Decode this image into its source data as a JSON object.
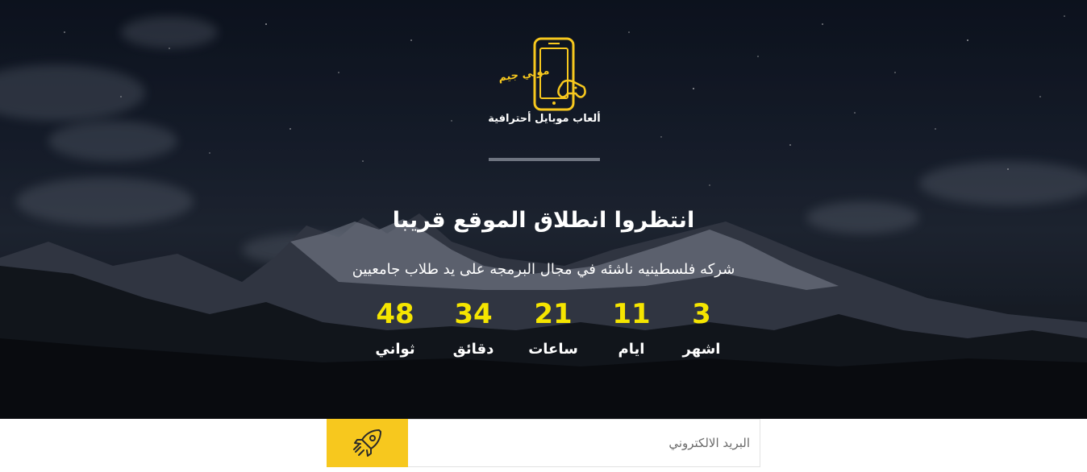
{
  "brand": {
    "name": "موبي جيم",
    "tagline": "ألعاب موبايل أحترافية"
  },
  "hero": {
    "headline": "انتظروا انطلاق الموقع قريبا",
    "subline": "شركه فلسطينيه ناشئه في مجال البرمجه على يد طلاب جامعيين"
  },
  "countdown": {
    "months": {
      "value": "3",
      "label": "اشهر"
    },
    "days": {
      "value": "11",
      "label": "ايام"
    },
    "hours": {
      "value": "21",
      "label": "ساعات"
    },
    "minutes": {
      "value": "34",
      "label": "دقائق"
    },
    "seconds": {
      "value": "48",
      "label": "ثواني"
    }
  },
  "subscribe": {
    "email_placeholder": "البريد الالكتروني",
    "button_icon": "rocket-icon"
  },
  "colors": {
    "accent": "#f7c81e",
    "countdown_number": "#f5e500",
    "divider": "#6e7480"
  }
}
